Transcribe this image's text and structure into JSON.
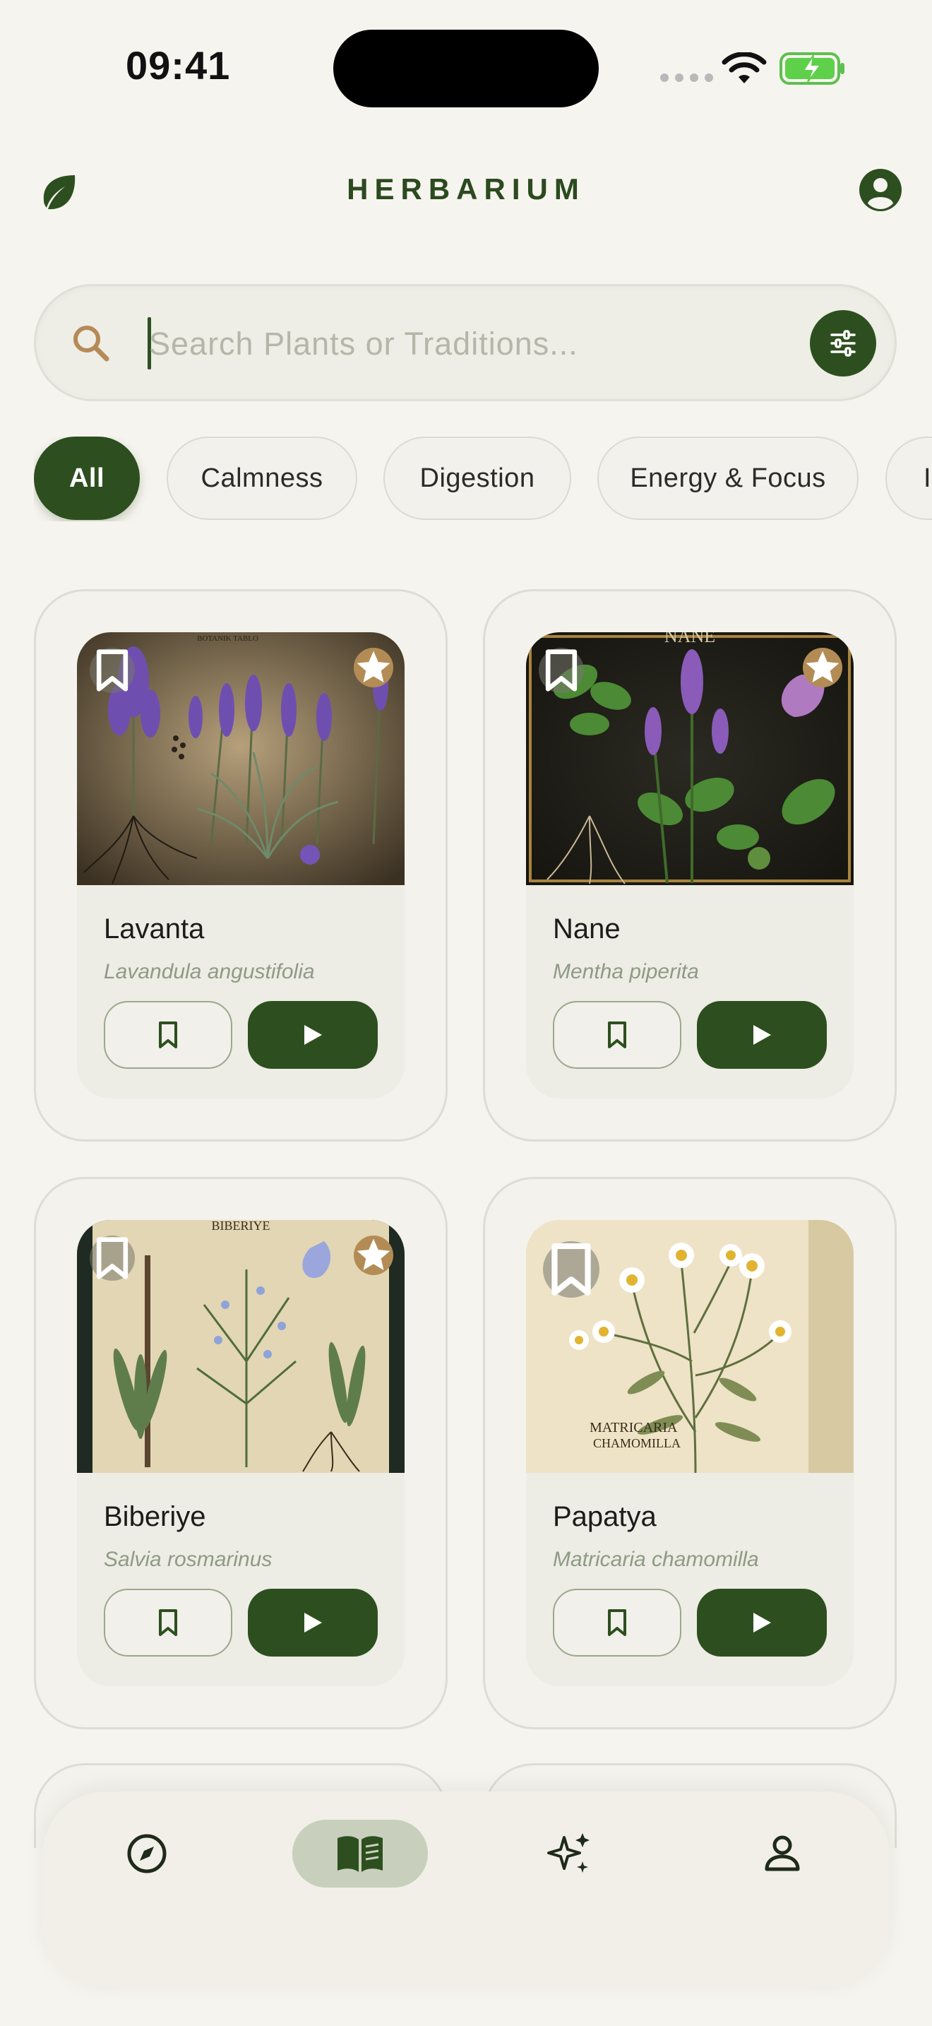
{
  "status_bar": {
    "time": "09:41"
  },
  "header": {
    "title": "HERBARIUM"
  },
  "search": {
    "placeholder": "Search Plants or Traditions..."
  },
  "chips": [
    {
      "label": "All",
      "active": true
    },
    {
      "label": "Calmness",
      "active": false
    },
    {
      "label": "Digestion",
      "active": false
    },
    {
      "label": "Energy & Focus",
      "active": false
    },
    {
      "label": "I",
      "active": false
    }
  ],
  "plants": [
    {
      "name": "Lavanta",
      "latin": "Lavandula angustifolia",
      "starred": true,
      "image": "lavender-illustration"
    },
    {
      "name": "Nane",
      "latin": "Mentha piperita",
      "starred": true,
      "image": "mint-illustration"
    },
    {
      "name": "Biberiye",
      "latin": "Salvia rosmarinus",
      "starred": true,
      "image": "rosemary-illustration"
    },
    {
      "name": "Papatya",
      "latin": "Matricaria chamomilla",
      "starred": false,
      "image": "chamomile-illustration"
    }
  ],
  "bottom_nav": [
    {
      "icon": "compass-icon",
      "active": false
    },
    {
      "icon": "book-icon",
      "active": true
    },
    {
      "icon": "sparkles-icon",
      "active": false
    },
    {
      "icon": "person-icon",
      "active": false
    }
  ],
  "colors": {
    "primary": "#2d4f1f",
    "accent": "#b38c55",
    "background": "#f6f4ef"
  }
}
